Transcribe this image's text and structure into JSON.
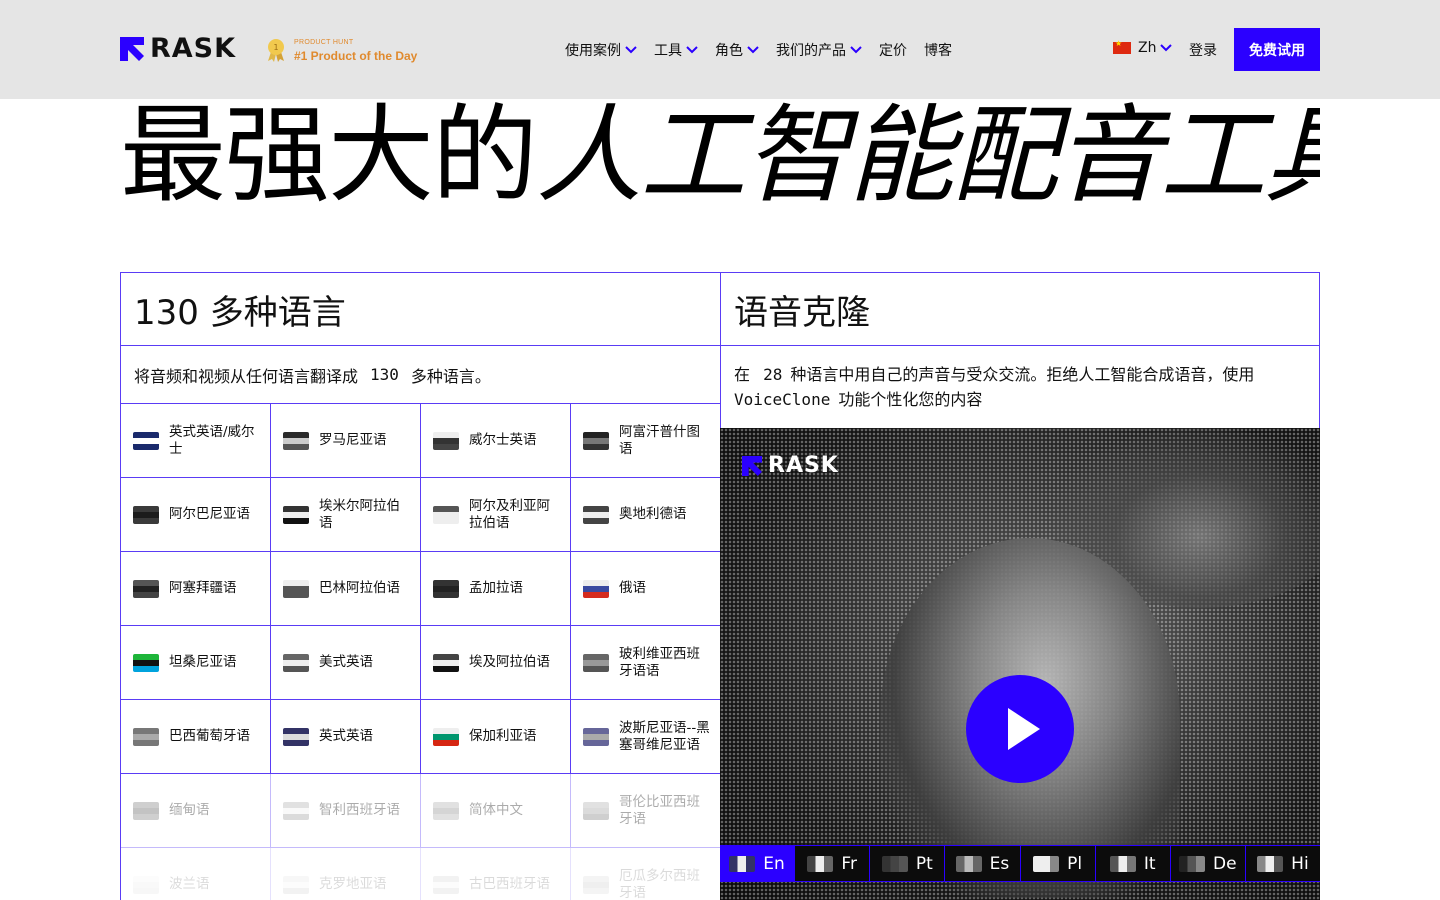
{
  "header": {
    "logo_text": "RASK",
    "product_hunt": {
      "small": "PRODUCT HUNT",
      "big": "#1 Product of the Day"
    },
    "nav": [
      {
        "label": "使用案例",
        "dropdown": true
      },
      {
        "label": "工具",
        "dropdown": true
      },
      {
        "label": "角色",
        "dropdown": true
      },
      {
        "label": "我们的产品",
        "dropdown": true
      },
      {
        "label": "定价",
        "dropdown": false
      },
      {
        "label": "博客",
        "dropdown": false
      }
    ],
    "language": "Zh",
    "login": "登录",
    "trial": "免费试用"
  },
  "hero": {
    "title_a": "最强大的",
    "title_b": "人工智能配音工具"
  },
  "left_panel": {
    "title": "130 多种语言",
    "desc_prefix": "将音频和视频从任何语言翻译成",
    "desc_number": "130",
    "desc_suffix": "多种语言。",
    "languages": [
      {
        "label": "英式英语/威尔士",
        "flag": [
          "#1a2a6c",
          "#ffffff",
          "#1a2a6c"
        ]
      },
      {
        "label": "罗马尼亚语",
        "flag": [
          "#2a2a2a",
          "#cccccc",
          "#555555"
        ]
      },
      {
        "label": "威尔士英语",
        "flag": [
          "#eeeeee",
          "#333333",
          "#444444"
        ]
      },
      {
        "label": "阿富汗普什图语",
        "flag": [
          "#222222",
          "#777777",
          "#333333"
        ]
      },
      {
        "label": "阿尔巴尼亚语",
        "flag": [
          "#3a3a3a",
          "#1c1c1c",
          "#3a3a3a"
        ]
      },
      {
        "label": "埃米尔阿拉伯语",
        "flag": [
          "#333333",
          "#eeeeee",
          "#111111"
        ]
      },
      {
        "label": "阿尔及利亚阿拉伯语",
        "flag": [
          "#555555",
          "#eeeeee",
          "#eeeeee"
        ]
      },
      {
        "label": "奥地利德语",
        "flag": [
          "#444444",
          "#eeeeee",
          "#444444"
        ]
      },
      {
        "label": "阿塞拜疆语",
        "flag": [
          "#555555",
          "#222222",
          "#444444"
        ]
      },
      {
        "label": "巴林阿拉伯语",
        "flag": [
          "#eeeeee",
          "#555555",
          "#555555"
        ]
      },
      {
        "label": "孟加拉语",
        "flag": [
          "#333333",
          "#222222",
          "#333333"
        ]
      },
      {
        "label": "俄语",
        "flag": [
          "#eeeeee",
          "#3a4aa0",
          "#d52b1e"
        ]
      },
      {
        "label": "坦桑尼亚语",
        "flag": [
          "#1eb53a",
          "#111111",
          "#00a3dd"
        ]
      },
      {
        "label": "美式英语",
        "flag": [
          "#666666",
          "#eeeeee",
          "#555555"
        ]
      },
      {
        "label": "埃及阿拉伯语",
        "flag": [
          "#444444",
          "#eeeeee",
          "#111111"
        ]
      },
      {
        "label": "玻利维亚西班牙语语",
        "flag": [
          "#666666",
          "#999999",
          "#555555"
        ]
      },
      {
        "label": "巴西葡萄牙语",
        "flag": [
          "#777777",
          "#aaaaaa",
          "#777777"
        ]
      },
      {
        "label": "英式英语",
        "flag": [
          "#333366",
          "#dddddd",
          "#333366"
        ]
      },
      {
        "label": "保加利亚语",
        "flag": [
          "#eeeeee",
          "#00966e",
          "#d62612"
        ]
      },
      {
        "label": "波斯尼亚语--黑塞哥维尼亚语",
        "flag": [
          "#666699",
          "#aaaaaa",
          "#666699"
        ]
      },
      {
        "label": "缅甸语",
        "flag": [
          "#777777",
          "#555555",
          "#777777"
        ]
      },
      {
        "label": "智利西班牙语",
        "flag": [
          "#aaaaaa",
          "#eeeeee",
          "#999999"
        ]
      },
      {
        "label": "简体中文",
        "flag": [
          "#aaaaaa",
          "#888888",
          "#aaaaaa"
        ]
      },
      {
        "label": "哥伦比亚西班牙语",
        "flag": [
          "#aaaaaa",
          "#999999",
          "#777777"
        ]
      },
      {
        "label": "波兰语",
        "flag": [
          "#eeeeee",
          "#dddddd",
          "#cccccc"
        ]
      },
      {
        "label": "克罗地亚语",
        "flag": [
          "#cccccc",
          "#eeeeee",
          "#aaaaaa"
        ]
      },
      {
        "label": "古巴西班牙语",
        "flag": [
          "#aaaaaa",
          "#eeeeee",
          "#aaaaaa"
        ]
      },
      {
        "label": "厄瓜多尔西班牙语",
        "flag": [
          "#bbbbbb",
          "#999999",
          "#bbbbbb"
        ]
      }
    ]
  },
  "right_panel": {
    "title": "语音克隆",
    "desc_prefix": "在",
    "desc_number": "28",
    "desc_middle": "种语言中用自己的声音与受众交流。拒绝人工智能合成语音，使用",
    "desc_mono": "VoiceClone",
    "desc_suffix": "功能个性化您的内容"
  },
  "video": {
    "logo_text": "RASK",
    "languages": [
      {
        "code": "En",
        "active": true,
        "flag": [
          "#333366",
          "#eeeeee",
          "#333366"
        ]
      },
      {
        "code": "Fr",
        "active": false,
        "flag": [
          "#444444",
          "#eeeeee",
          "#666666"
        ]
      },
      {
        "code": "Pt",
        "active": false,
        "flag": [
          "#333333",
          "#444444",
          "#555555"
        ]
      },
      {
        "code": "Es",
        "active": false,
        "flag": [
          "#666666",
          "#bbbbbb",
          "#666666"
        ]
      },
      {
        "code": "Pl",
        "active": false,
        "flag": [
          "#eeeeee",
          "#eeeeee",
          "#888888"
        ]
      },
      {
        "code": "It",
        "active": false,
        "flag": [
          "#555555",
          "#eeeeee",
          "#777777"
        ]
      },
      {
        "code": "De",
        "active": false,
        "flag": [
          "#222222",
          "#555555",
          "#888888"
        ]
      },
      {
        "code": "Hi",
        "active": false,
        "flag": [
          "#888888",
          "#eeeeee",
          "#555555"
        ]
      }
    ]
  },
  "colors": {
    "accent": "#2b00ff",
    "border": "#5a3cf5",
    "header_bg": "#e5e5e5",
    "product_hunt": "#e08a2e"
  }
}
